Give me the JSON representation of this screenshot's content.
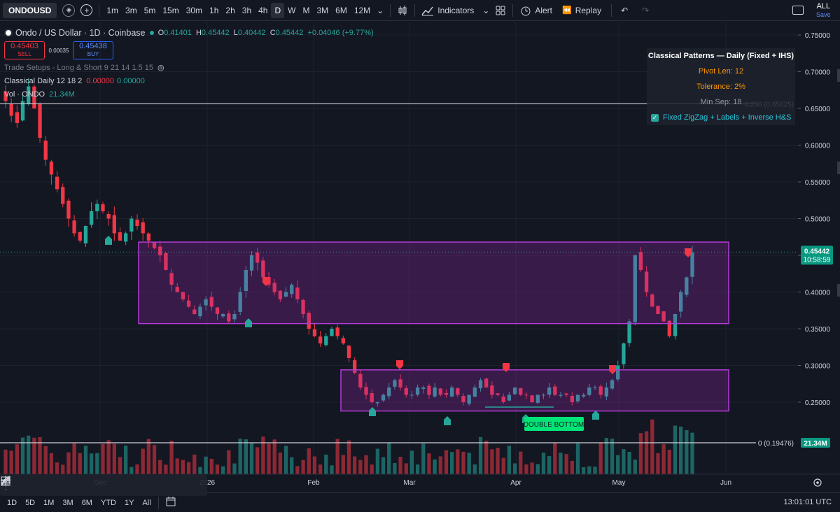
{
  "toolbar": {
    "symbol": "ONDOUSD",
    "intervals": [
      "1m",
      "3m",
      "5m",
      "15m",
      "30m",
      "1h",
      "2h",
      "3h",
      "4h",
      "D",
      "W",
      "M",
      "3M",
      "6M",
      "12M"
    ],
    "active_interval": "D",
    "indicators_label": "Indicators",
    "alert_label": "Alert",
    "replay_label": "Replay",
    "all_label": "ALL",
    "save_label": "Save"
  },
  "legend": {
    "title": "Ondo / US Dollar · 1D · Coinbase",
    "o_label": "O",
    "o": "0.41401",
    "h_label": "H",
    "h": "0.45442",
    "l_label": "L",
    "l": "0.40442",
    "c_label": "C",
    "c": "0.45442",
    "change": "+0.04046 (+9.77%)",
    "sell_price": "0.45403",
    "sell_label": "SELL",
    "spread": "0.00035",
    "buy_price": "0.45438",
    "buy_label": "BUY",
    "indicator1": "Trade Setups - Long & Short 9 21 14 1.5 15",
    "indicator2_name": "Classical Daily 12 18 2",
    "indicator2_v1": "0.00000",
    "indicator2_v2": "0.00000",
    "vol_label": "Vol · ONDO",
    "vol_value": "21.34M"
  },
  "pattern_table": {
    "title": "Classical Patterns — Daily (Fixed + IHS)",
    "pivot_len": "Pivot Len: 12",
    "tolerance": "Tolerance: 2%",
    "min_sep": "Min Sep: 18",
    "checkbox_label": "Fixed ZigZag + Labels + Inverse H&S"
  },
  "price_axis": {
    "ticks": [
      "0.75000",
      "0.70000",
      "0.65000",
      "0.60000",
      "0.55000",
      "0.50000",
      "0.45000",
      "0.40000",
      "0.35000",
      "0.30000",
      "0.25000"
    ],
    "current_price": "0.45442",
    "countdown": "10:58:59",
    "fib_upper_label": "0.236 (0.65625)",
    "fib_lower_label": "0 (0.19476)",
    "volume_badge": "21.34M"
  },
  "time_axis": {
    "labels": [
      "Dec",
      "2026",
      "Feb",
      "Mar",
      "Apr",
      "May",
      "Jun"
    ]
  },
  "pattern_label": "DOUBLE BOTTOM",
  "bottom": {
    "ranges": [
      "1D",
      "5D",
      "1M",
      "3M",
      "6M",
      "YTD",
      "1Y",
      "All"
    ],
    "clock": "13:01:01 UTC"
  },
  "colors": {
    "up": "#26a69a",
    "down": "#f23645",
    "box": "#9c27b0",
    "accent": "#2962ff"
  },
  "chart_data": {
    "type": "candlestick",
    "symbol": "ONDOUSD",
    "ohlc_last": {
      "open": 0.41401,
      "high": 0.45442,
      "low": 0.40442,
      "close": 0.45442
    },
    "ylim": [
      0.19476,
      0.76
    ],
    "x_labels": [
      "Dec",
      "2026",
      "Feb",
      "Mar",
      "Apr",
      "May",
      "Jun"
    ],
    "close_path": [
      0.66,
      0.64,
      0.63,
      0.66,
      0.68,
      0.65,
      0.61,
      0.58,
      0.56,
      0.54,
      0.52,
      0.5,
      0.48,
      0.47,
      0.49,
      0.51,
      0.52,
      0.51,
      0.5,
      0.48,
      0.47,
      0.48,
      0.5,
      0.49,
      0.48,
      0.47,
      0.46,
      0.45,
      0.43,
      0.41,
      0.4,
      0.39,
      0.38,
      0.37,
      0.38,
      0.39,
      0.38,
      0.37,
      0.37,
      0.36,
      0.37,
      0.4,
      0.43,
      0.45,
      0.44,
      0.42,
      0.41,
      0.4,
      0.39,
      0.4,
      0.41,
      0.39,
      0.37,
      0.35,
      0.34,
      0.33,
      0.34,
      0.35,
      0.34,
      0.33,
      0.31,
      0.29,
      0.27,
      0.26,
      0.25,
      0.25,
      0.26,
      0.27,
      0.28,
      0.27,
      0.26,
      0.26,
      0.27,
      0.27,
      0.26,
      0.27,
      0.26,
      0.26,
      0.27,
      0.26,
      0.25,
      0.26,
      0.27,
      0.28,
      0.27,
      0.26,
      0.26,
      0.25,
      0.26,
      0.27,
      0.26,
      0.26,
      0.25,
      0.26,
      0.26,
      0.27,
      0.26,
      0.26,
      0.26,
      0.25,
      0.26,
      0.26,
      0.27,
      0.27,
      0.26,
      0.27,
      0.28,
      0.3,
      0.33,
      0.36,
      0.45,
      0.43,
      0.4,
      0.38,
      0.37,
      0.36,
      0.34,
      0.37,
      0.4,
      0.42,
      0.454
    ],
    "boxes": [
      {
        "from_index": 28,
        "to_index": 130,
        "top": 0.468,
        "bottom": 0.357
      },
      {
        "from_index": 69,
        "to_index": 130,
        "top": 0.294,
        "bottom": 0.238
      }
    ],
    "horizontal_lines": [
      {
        "value": 0.65625,
        "label": "0.236 (0.65625)"
      },
      {
        "value": 0.19476,
        "label": "0 (0.19476)"
      }
    ],
    "volume_last": "21.34M"
  }
}
